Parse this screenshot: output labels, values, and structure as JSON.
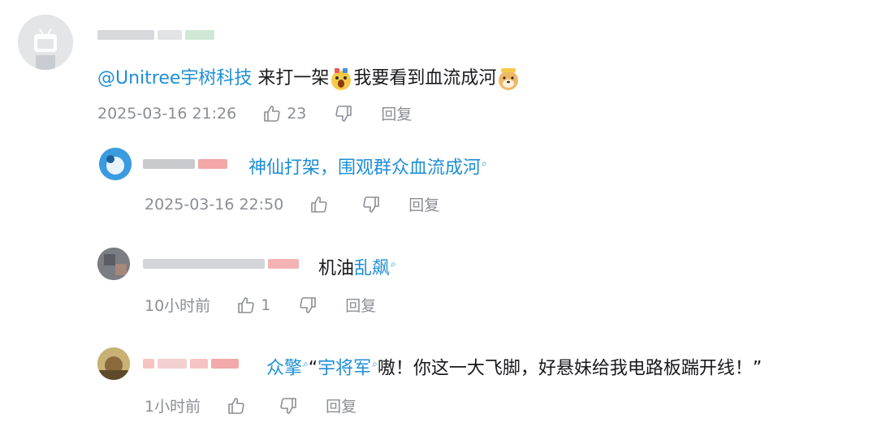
{
  "comment": {
    "mention": "@Unitree宇树科技",
    "text_a": " 来打一架",
    "text_b": "我要看到血流成河",
    "timestamp": "2025-03-16 21:26",
    "likes": "23",
    "reply_label": "回复"
  },
  "replies": [
    {
      "text": "神仙打架，围观群众血流成河",
      "timestamp": "2025-03-16 22:50",
      "likes": "",
      "reply_label": "回复"
    },
    {
      "text_plain": "机油",
      "text_link": "乱飙",
      "timestamp": "10小时前",
      "likes": "1",
      "reply_label": "回复"
    },
    {
      "link1": "众擎",
      "quote_open": "“",
      "link2": "宇将军",
      "text": "嗷！你这一大飞脚，好悬妹给我电路板踹开线！”",
      "timestamp": "1小时前",
      "likes": "",
      "reply_label": "回复"
    }
  ],
  "colors": {
    "link": "#1e8fd6",
    "meta": "#8b8e93",
    "text": "#18191c"
  },
  "icons": {
    "like": "thumb-up-icon",
    "dislike": "thumb-down-icon",
    "search": "search-icon"
  }
}
